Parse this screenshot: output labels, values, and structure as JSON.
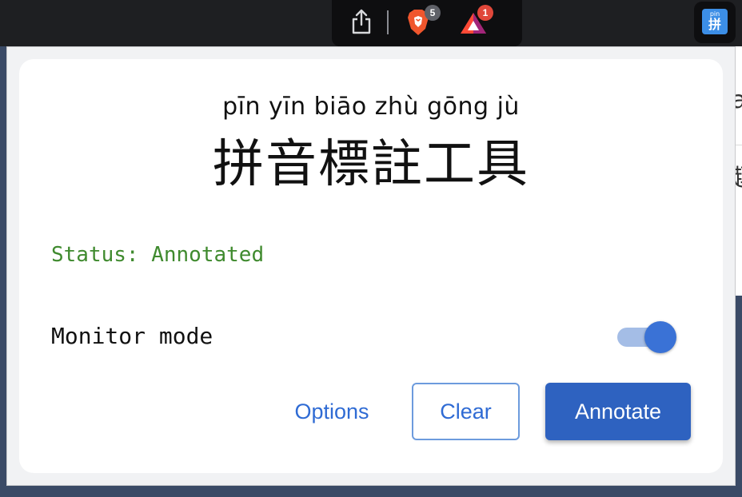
{
  "toolbar": {
    "brave_badge": "5",
    "rewards_badge": "1",
    "extension_icon_small": "pin",
    "extension_icon_big": "拼"
  },
  "background": {
    "edge_char_1": "a",
    "edge_char_2": "趣"
  },
  "popup": {
    "pinyin": "pīn yīn biāo zhù gōng jù",
    "title": "拼音標註工具",
    "status": "Status: Annotated",
    "monitor_label": "Monitor mode",
    "monitor_enabled": true
  },
  "buttons": {
    "options": "Options",
    "clear": "Clear",
    "annotate": "Annotate"
  },
  "colors": {
    "status_green": "#3f8a2e",
    "accent_blue": "#2e62c0",
    "toggle_track": "#a4bde6"
  }
}
